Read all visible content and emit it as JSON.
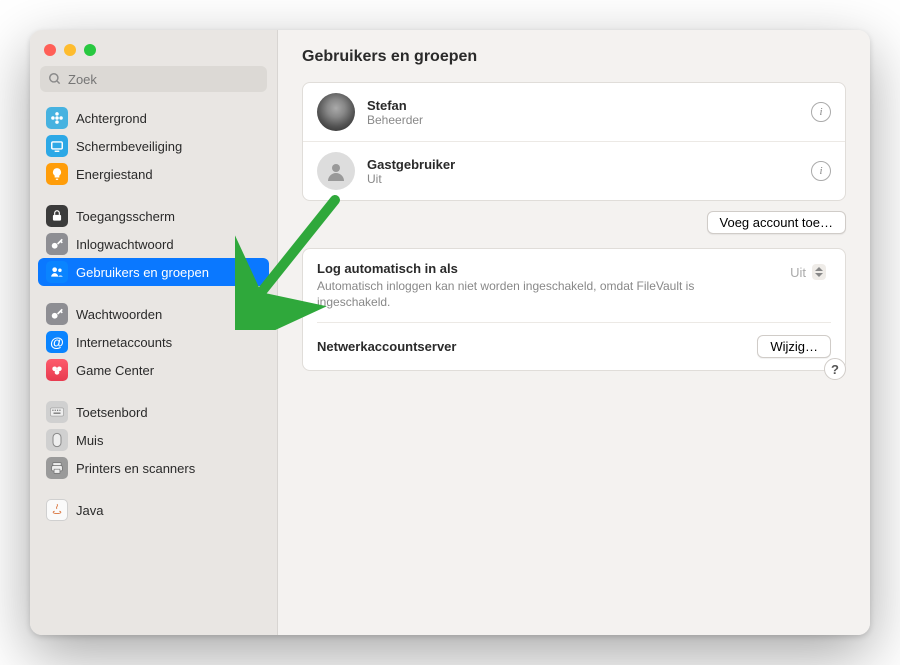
{
  "window": {
    "title": "Gebruikers en groepen"
  },
  "search": {
    "placeholder": "Zoek"
  },
  "sidebar": {
    "groups": [
      {
        "items": [
          {
            "name": "achtergrond",
            "label": "Achtergrond",
            "icon": "flower-icon",
            "iconBg": "ic-cyan"
          },
          {
            "name": "schermbeveiliging",
            "label": "Schermbeveiliging",
            "icon": "screen-icon",
            "iconBg": "ic-lblue"
          },
          {
            "name": "energiestand",
            "label": "Energiestand",
            "icon": "bulb-icon",
            "iconBg": "ic-orange"
          }
        ]
      },
      {
        "items": [
          {
            "name": "toegangsscherm",
            "label": "Toegangsscherm",
            "icon": "lock-icon",
            "iconBg": "ic-black"
          },
          {
            "name": "inlogwachtwoord",
            "label": "Inlogwachtwoord",
            "icon": "key-icon",
            "iconBg": "ic-gray"
          },
          {
            "name": "gebruikers-en-groepen",
            "label": "Gebruikers en groepen",
            "icon": "users-icon",
            "iconBg": "ic-blue",
            "selected": true
          }
        ]
      },
      {
        "items": [
          {
            "name": "wachtwoorden",
            "label": "Wachtwoorden",
            "icon": "key-icon",
            "iconBg": "ic-gray"
          },
          {
            "name": "internetaccounts",
            "label": "Internetaccounts",
            "icon": "at-icon",
            "iconBg": "ic-at"
          },
          {
            "name": "game-center",
            "label": "Game Center",
            "icon": "game-icon",
            "iconBg": "ic-red"
          }
        ]
      },
      {
        "items": [
          {
            "name": "toetsenbord",
            "label": "Toetsenbord",
            "icon": "keyboard-icon",
            "iconBg": "ic-keyb"
          },
          {
            "name": "muis",
            "label": "Muis",
            "icon": "mouse-icon",
            "iconBg": "ic-mouse"
          },
          {
            "name": "printers-en-scanners",
            "label": "Printers en scanners",
            "icon": "printer-icon",
            "iconBg": "ic-print"
          }
        ]
      },
      {
        "items": [
          {
            "name": "java",
            "label": "Java",
            "icon": "java-icon",
            "iconBg": "ic-java"
          }
        ]
      }
    ]
  },
  "users": [
    {
      "name": "Stefan",
      "role": "Beheerder",
      "avatar": "wolf"
    },
    {
      "name": "Gastgebruiker",
      "role": "Uit",
      "avatar": "guest"
    }
  ],
  "buttons": {
    "add_account": "Voeg account toe…",
    "edit_network": "Wijzig…"
  },
  "auto_login": {
    "title": "Log automatisch in als",
    "value": "Uit",
    "description": "Automatisch inloggen kan niet worden ingeschakeld, omdat FileVault is ingeschakeld."
  },
  "network_server": {
    "title": "Netwerkaccountserver"
  },
  "help": "?",
  "colors": {
    "accent": "#0a78ff",
    "annotation": "#2fa83b"
  }
}
